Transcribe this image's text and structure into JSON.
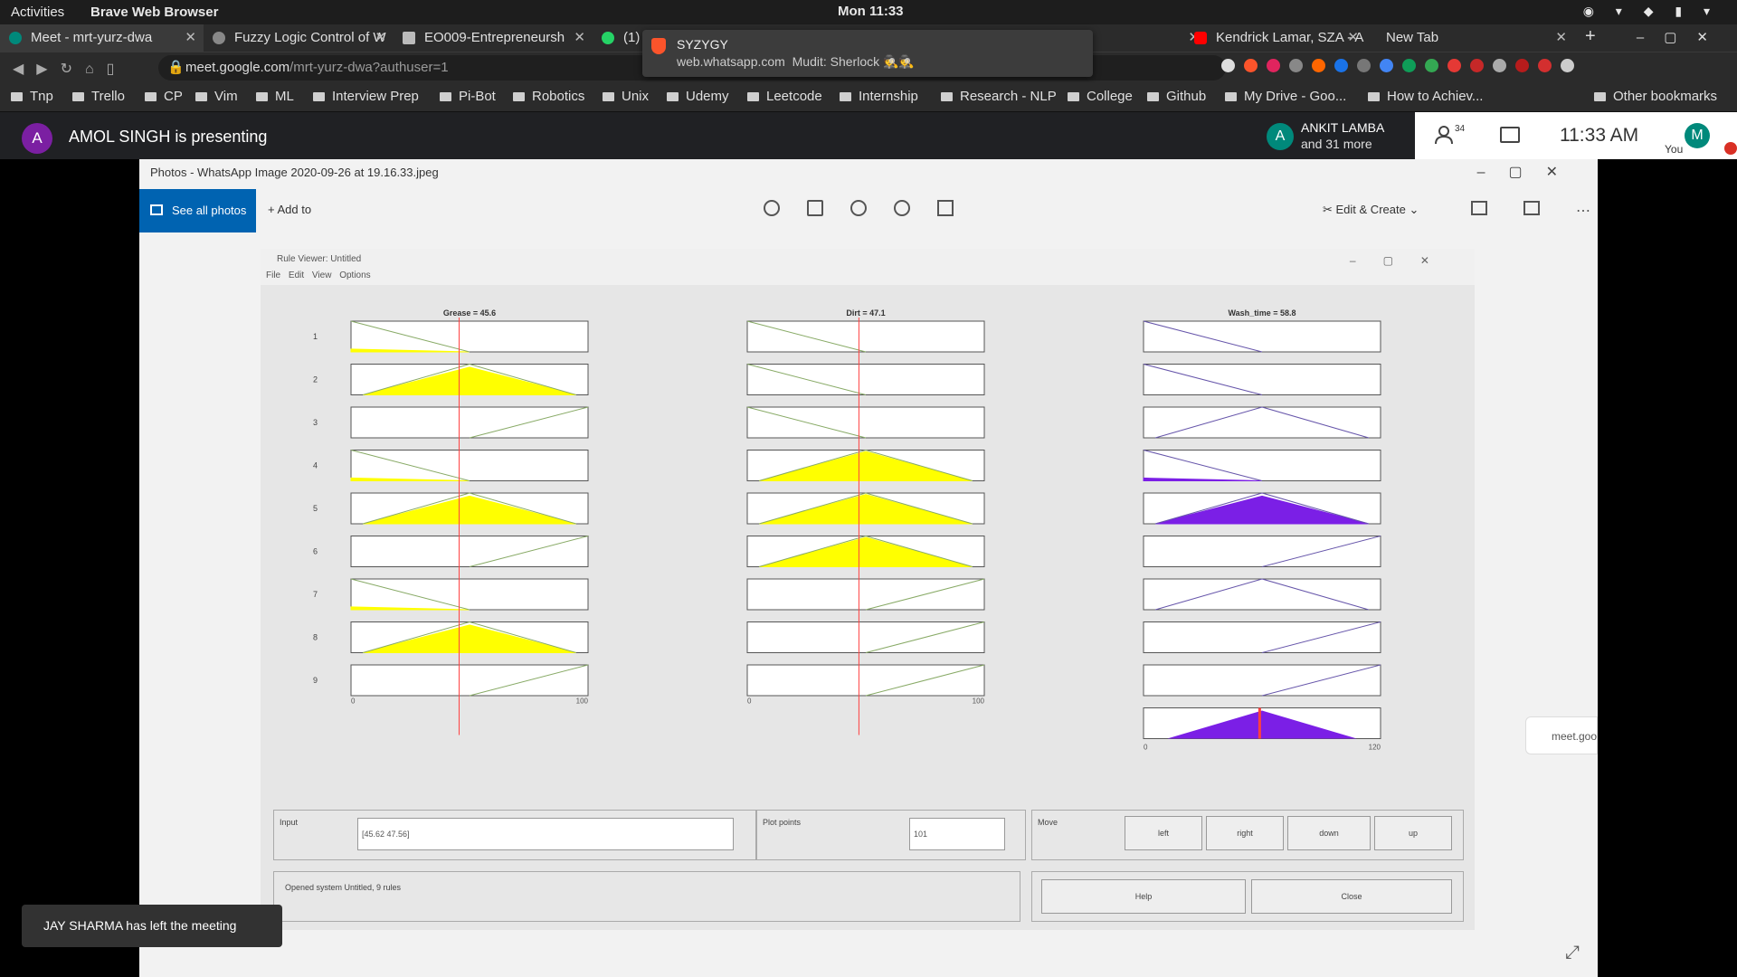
{
  "system": {
    "activities": "Activities",
    "app": "Brave Web Browser",
    "clock": "Mon 11:33"
  },
  "tabs": [
    {
      "label": "Meet - mrt-yurz-dwa",
      "active": true
    },
    {
      "label": "Fuzzy Logic Control of W"
    },
    {
      "label": "EO009-Entrepreneursh"
    },
    {
      "label": "(1)"
    },
    {
      "label": "Kendrick Lamar, SZA - A"
    },
    {
      "label": "New Tab"
    }
  ],
  "notification": {
    "title": "SYZYGY",
    "site": "web.whatsapp.com",
    "text": "Mudit: Sherlock 🕵️🕵️"
  },
  "address": {
    "host": "meet.google.com",
    "path": "/mrt-yurz-dwa?authuser=1"
  },
  "bookmarks": [
    "Tnp",
    "Trello",
    "CP",
    "Vim",
    "ML",
    "Interview Prep",
    "Pi-Bot",
    "Robotics",
    "Unix",
    "Udemy",
    "Leetcode",
    "Internship",
    "Research - NLP",
    "College",
    "Github",
    "My Drive - Goo...",
    "How to Achiev...",
    "Other bookmarks"
  ],
  "meet": {
    "presenter_initial": "A",
    "presenter": "AMOL SINGH is presenting",
    "participant_initial": "A",
    "participant": "ANKIT LAMBA",
    "participant_more": "and 31 more",
    "people_count": "34",
    "time": "11:33 AM",
    "me_initial": "M",
    "me_label": "You",
    "toast": "JAY SHARMA has left the meeting",
    "pill": "meet.goo"
  },
  "photos": {
    "title": "Photos - WhatsApp Image 2020-09-26 at 19.16.33.jpeg",
    "see_all": "See all photos",
    "add_to": "Add to",
    "edit_create": "Edit & Create"
  },
  "rule_viewer": {
    "window_title": "Rule Viewer: Untitled",
    "menu": [
      "File",
      "Edit",
      "View",
      "Options"
    ],
    "input_label": "Input",
    "input_value": "[45.62 47.56]",
    "plot_points_label": "Plot points",
    "plot_points_value": "101",
    "move_label": "Move",
    "move_buttons": [
      "left",
      "right",
      "down",
      "up"
    ],
    "status": "Opened system Untitled, 9 rules",
    "help": "Help",
    "close": "Close"
  },
  "colors": {
    "input_fill": "#ffff00",
    "output_fill": "#7b1fe6",
    "rule_line": "#ff4040"
  },
  "chart_data": {
    "type": "rule-viewer",
    "columns": [
      {
        "title": "Grease = 45.6",
        "range": [
          0,
          100
        ],
        "ticks": [
          "0",
          "100"
        ],
        "line": 45.6
      },
      {
        "title": "Dirt = 47.1",
        "range": [
          0,
          100
        ],
        "ticks": [
          "0",
          "100"
        ],
        "line": 47.1
      },
      {
        "title": "Wash_time = 58.8",
        "range": [
          0,
          120
        ],
        "ticks": [
          "0",
          "120"
        ]
      }
    ],
    "rules": [
      {
        "n": "1",
        "mf": [
          "low",
          "low",
          "low"
        ],
        "fill": [
          0.09,
          0,
          0
        ]
      },
      {
        "n": "2",
        "mf": [
          "mid",
          "low",
          "low"
        ],
        "fill": [
          0.9,
          0,
          0
        ]
      },
      {
        "n": "3",
        "mf": [
          "high",
          "low",
          "mid"
        ],
        "fill": [
          0,
          0,
          0
        ]
      },
      {
        "n": "4",
        "mf": [
          "low",
          "mid",
          "low"
        ],
        "fill": [
          0.09,
          0.95,
          0.09
        ]
      },
      {
        "n": "5",
        "mf": [
          "mid",
          "mid",
          "mid"
        ],
        "fill": [
          0.9,
          0.95,
          0.9
        ]
      },
      {
        "n": "6",
        "mf": [
          "high",
          "mid",
          "high"
        ],
        "fill": [
          0,
          0.95,
          0
        ]
      },
      {
        "n": "7",
        "mf": [
          "low",
          "high",
          "mid"
        ],
        "fill": [
          0.09,
          0,
          0
        ]
      },
      {
        "n": "8",
        "mf": [
          "mid",
          "high",
          "high"
        ],
        "fill": [
          0.9,
          0,
          0
        ]
      },
      {
        "n": "9",
        "mf": [
          "high",
          "high",
          "high"
        ],
        "fill": [
          0,
          0,
          0
        ]
      }
    ]
  }
}
